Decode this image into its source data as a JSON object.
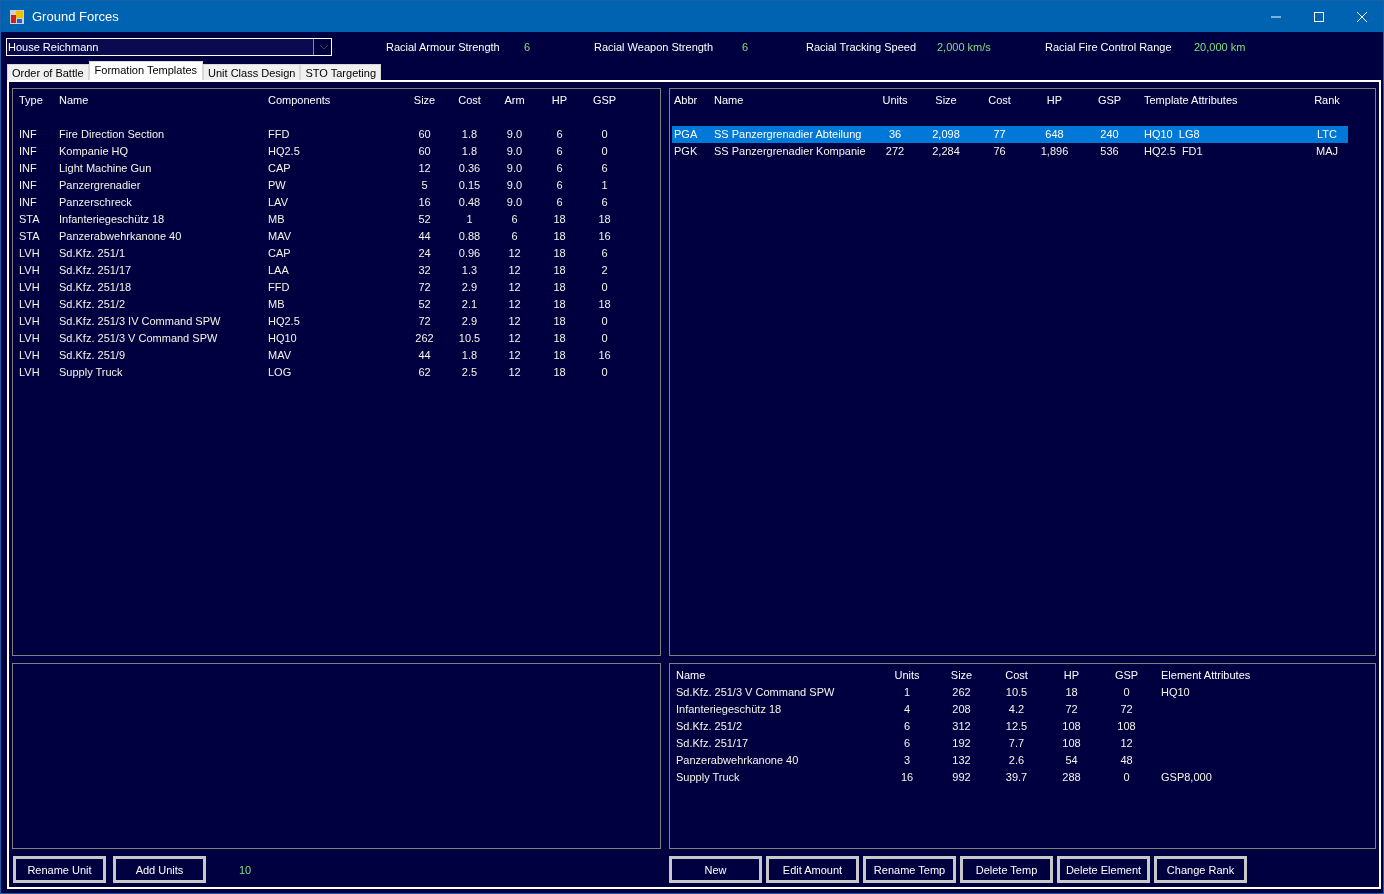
{
  "window": {
    "title": "Ground Forces"
  },
  "race_select": {
    "value": "House Reichmann"
  },
  "stats": [
    {
      "label": "Racial Armour Strength",
      "value": "6"
    },
    {
      "label": "Racial Weapon Strength",
      "value": "6"
    },
    {
      "label": "Racial Tracking Speed",
      "value": "2,000 km/s"
    },
    {
      "label": "Racial Fire Control Range",
      "value": "20,000 km"
    }
  ],
  "tabs": [
    {
      "label": "Order of Battle",
      "selected": false
    },
    {
      "label": "Formation Templates",
      "selected": true
    },
    {
      "label": "Unit Class Design",
      "selected": false
    },
    {
      "label": "STO Targeting",
      "selected": false
    }
  ],
  "unit_classes": {
    "columns": [
      "Type",
      "Name",
      "Components",
      "Size",
      "Cost",
      "Arm",
      "HP",
      "GSP"
    ],
    "rows": [
      [
        "INF",
        "Fire Direction Section",
        "FFD",
        "60",
        "1.8",
        "9.0",
        "6",
        "0"
      ],
      [
        "INF",
        "Kompanie HQ",
        "HQ2.5",
        "60",
        "1.8",
        "9.0",
        "6",
        "0"
      ],
      [
        "INF",
        "Light Machine Gun",
        "CAP",
        "12",
        "0.36",
        "9.0",
        "6",
        "6"
      ],
      [
        "INF",
        "Panzergrenadier",
        "PW",
        "5",
        "0.15",
        "9.0",
        "6",
        "1"
      ],
      [
        "INF",
        "Panzerschreck",
        "LAV",
        "16",
        "0.48",
        "9.0",
        "6",
        "6"
      ],
      [
        "STA",
        "Infanteriegeschütz 18",
        "MB",
        "52",
        "1",
        "6",
        "18",
        "18"
      ],
      [
        "STA",
        "Panzerabwehrkanone 40",
        "MAV",
        "44",
        "0.88",
        "6",
        "18",
        "16"
      ],
      [
        "LVH",
        "Sd.Kfz. 251/1",
        "CAP",
        "24",
        "0.96",
        "12",
        "18",
        "6"
      ],
      [
        "LVH",
        "Sd.Kfz. 251/17",
        "LAA",
        "32",
        "1.3",
        "12",
        "18",
        "2"
      ],
      [
        "LVH",
        "Sd.Kfz. 251/18",
        "FFD",
        "72",
        "2.9",
        "12",
        "18",
        "0"
      ],
      [
        "LVH",
        "Sd.Kfz. 251/2",
        "MB",
        "52",
        "2.1",
        "12",
        "18",
        "18"
      ],
      [
        "LVH",
        "Sd.Kfz. 251/3 IV Command SPW",
        "HQ2.5",
        "72",
        "2.9",
        "12",
        "18",
        "0"
      ],
      [
        "LVH",
        "Sd.Kfz. 251/3 V Command SPW",
        "HQ10",
        "262",
        "10.5",
        "12",
        "18",
        "0"
      ],
      [
        "LVH",
        "Sd.Kfz. 251/9",
        "MAV",
        "44",
        "1.8",
        "12",
        "18",
        "16"
      ],
      [
        "LVH",
        "Supply Truck",
        "LOG",
        "62",
        "2.5",
        "12",
        "18",
        "0"
      ]
    ]
  },
  "templates": {
    "columns": [
      "Abbr",
      "Name",
      "Units",
      "Size",
      "Cost",
      "HP",
      "GSP",
      "Template Attributes",
      "Rank"
    ],
    "rows": [
      {
        "cells": [
          "PGA",
          "SS Panzergrenadier Abteilung",
          "36",
          "2,098",
          "77",
          "648",
          "240",
          "HQ10  LG8",
          "LTC"
        ],
        "selected": true
      },
      {
        "cells": [
          "PGK",
          "SS Panzergrenadier Kompanie",
          "272",
          "2,284",
          "76",
          "1,896",
          "536",
          "HQ2.5  FD1",
          "MAJ"
        ],
        "selected": false
      }
    ]
  },
  "elements": {
    "columns": [
      "Name",
      "Units",
      "Size",
      "Cost",
      "HP",
      "GSP",
      "Element Attributes"
    ],
    "rows": [
      [
        "Sd.Kfz. 251/3 V Command SPW",
        "1",
        "262",
        "10.5",
        "18",
        "0",
        "HQ10"
      ],
      [
        "Infanteriegeschütz 18",
        "4",
        "208",
        "4.2",
        "72",
        "72",
        ""
      ],
      [
        "Sd.Kfz. 251/2",
        "6",
        "312",
        "12.5",
        "108",
        "108",
        ""
      ],
      [
        "Sd.Kfz. 251/17",
        "6",
        "192",
        "7.7",
        "108",
        "12",
        ""
      ],
      [
        "Panzerabwehrkanone 40",
        "3",
        "132",
        "2.6",
        "54",
        "48",
        ""
      ],
      [
        "Supply Truck",
        "16",
        "992",
        "39.7",
        "288",
        "0",
        "GSP8,000"
      ]
    ]
  },
  "unit_buttons": [
    "Rename Unit",
    "Add Units"
  ],
  "units_to_add": "10",
  "template_buttons": [
    "New",
    "Edit Amount",
    "Rename Temp",
    "Delete Temp",
    "Delete Element",
    "Change Rank"
  ]
}
